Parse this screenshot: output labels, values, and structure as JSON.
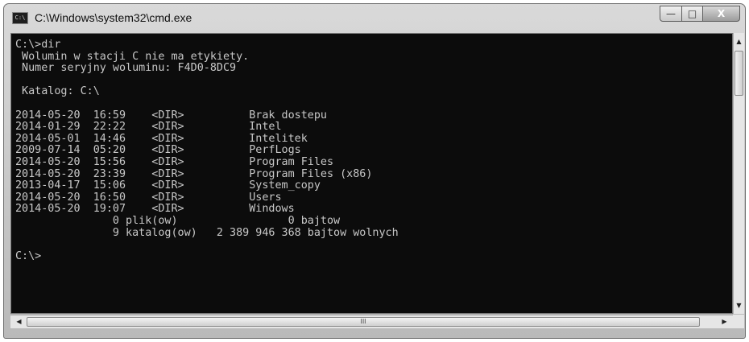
{
  "window": {
    "title": "C:\\Windows\\system32\\cmd.exe",
    "app_icon": "C:\\",
    "controls": {
      "minimize": "—",
      "maximize": "□",
      "close": "X"
    }
  },
  "console": {
    "lines": [
      "C:\\>dir",
      " Wolumin w stacji C nie ma etykiety.",
      " Numer seryjny woluminu: F4D0-8DC9",
      "",
      " Katalog: C:\\",
      "",
      "2014-05-20  16:59    <DIR>          Brak dostepu",
      "2014-01-29  22:22    <DIR>          Intel",
      "2014-05-01  14:46    <DIR>          Intelitek",
      "2009-07-14  05:20    <DIR>          PerfLogs",
      "2014-05-20  15:56    <DIR>          Program Files",
      "2014-05-20  23:39    <DIR>          Program Files (x86)",
      "2013-04-17  15:06    <DIR>          System_copy",
      "2014-05-20  16:50    <DIR>          Users",
      "2014-05-20  19:07    <DIR>          Windows",
      "               0 plik(ow)                 0 bajtow",
      "               9 katalog(ow)   2 389 946 368 bajtow wolnych",
      "",
      "C:\\>"
    ]
  },
  "scrollbars": {
    "up_arrow": "▲",
    "down_arrow": "▼",
    "left_arrow": "◀",
    "right_arrow": "▶",
    "h_thumb_grip": "III"
  }
}
